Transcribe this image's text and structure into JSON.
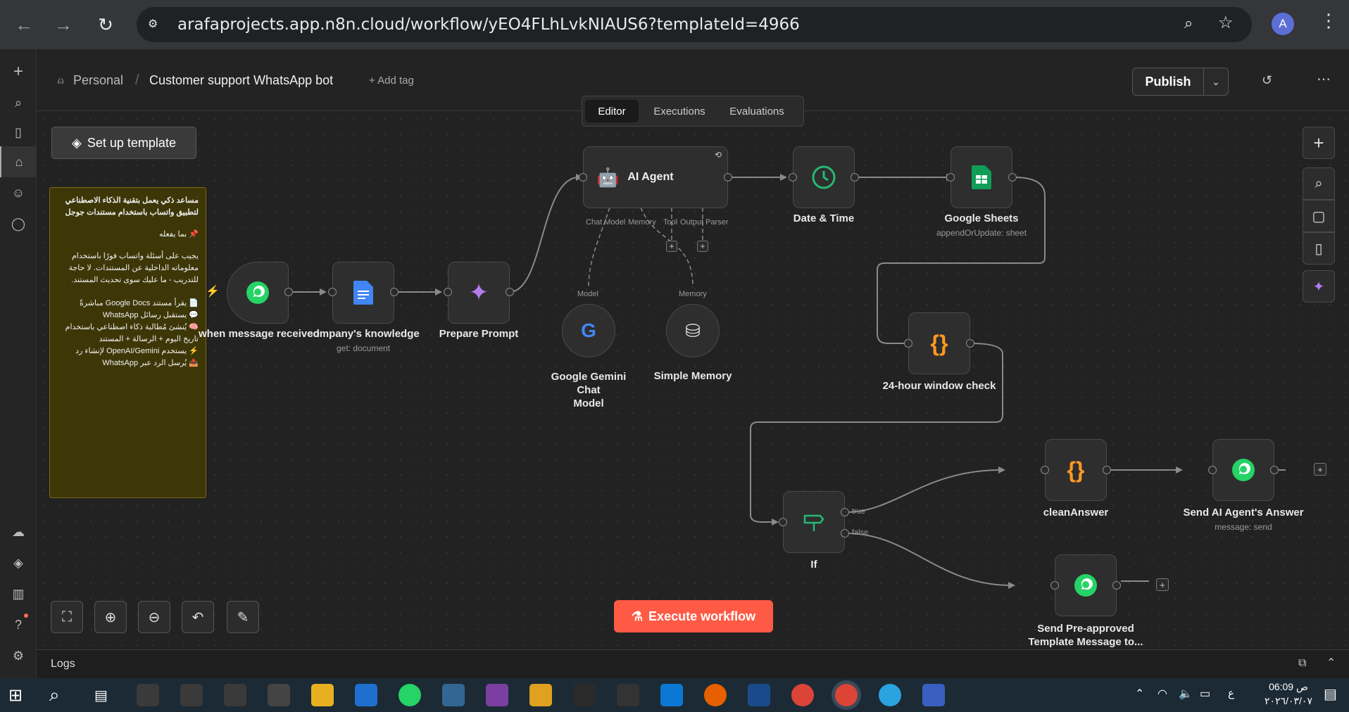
{
  "browser": {
    "url": "arafaprojects.app.n8n.cloud/workflow/yEO4FLhLvkNIAUS6?templateId=4966",
    "avatar": "A"
  },
  "header": {
    "project": "Personal",
    "separator": "/",
    "workflow_name": "Customer support WhatsApp bot",
    "add_tag": "+ Add tag",
    "publish": "Publish"
  },
  "tabs": [
    "Editor",
    "Executions",
    "Evaluations"
  ],
  "setup_template": "Set up template",
  "sticky_note": {
    "title_line1": "مساعد ذكي يعمل بتقنية الذكاء الاصطناعي",
    "title_line2": "لتطبيق واتساب باستخدام مستندات جوجل",
    "sub": "📌 بما يفعله",
    "p1": "يجيب على أسئلة واتساب فورًا باستخدام",
    "p2": "معلوماته الداخلية عن المستندات. لا حاجة",
    "p3": "للتدريب - ما عليك سوى تحديث المستند.",
    "l1": "📄 يقرأ مستند Google Docs مباشرةً",
    "l2": "💬 يستقبل رسائل WhatsApp",
    "l3": "🧠 يُنشئ مُطالبة ذكاء اصطناعي باستخدام",
    "l4": "تاريخ اليوم + الرسالة + المستند",
    "l5": "⚡ يستخدم OpenAI/Gemini لإنشاء رد",
    "l6": "📤 يُرسل الرد عبر WhatsApp"
  },
  "nodes": {
    "trigger": "when message received",
    "knowledge": "company's knowledge",
    "knowledge_sub": "get: document",
    "prepare": "Prepare Prompt",
    "agent": "AI Agent",
    "agent_chat_model": "Chat Model",
    "agent_memory": "Memory",
    "agent_tool": "Tool",
    "agent_output": "Output Parser",
    "gemini": "Google Gemini Chat Model",
    "gemini_line1": "Google Gemini Chat",
    "gemini_line2": "Model",
    "gemini_conn": "Model",
    "memory": "Simple Memory",
    "memory_conn": "Memory",
    "datetime": "Date & Time",
    "sheets": "Google Sheets",
    "sheets_sub": "appendOrUpdate: sheet",
    "window_check": "24-hour window check",
    "if": "If",
    "if_true": "true",
    "if_false": "false",
    "clean": "cleanAnswer",
    "send_answer": "Send AI Agent's Answer",
    "send_answer_sub": "message: send",
    "send_template_line1": "Send Pre-approved",
    "send_template_line2": "Template Message to..."
  },
  "execute_button": "Execute workflow",
  "logs": "Logs",
  "taskbar": {
    "time": "06:09 ص",
    "date": "٢٠٢٦/٠٣/٠٧",
    "lang": "ع"
  },
  "colors": {
    "accent": "#ff6d5a",
    "whatsapp": "#25d366",
    "code_orange": "#ff9922",
    "sticky": "#3d3708",
    "sheets_green": "#0f9d58"
  }
}
